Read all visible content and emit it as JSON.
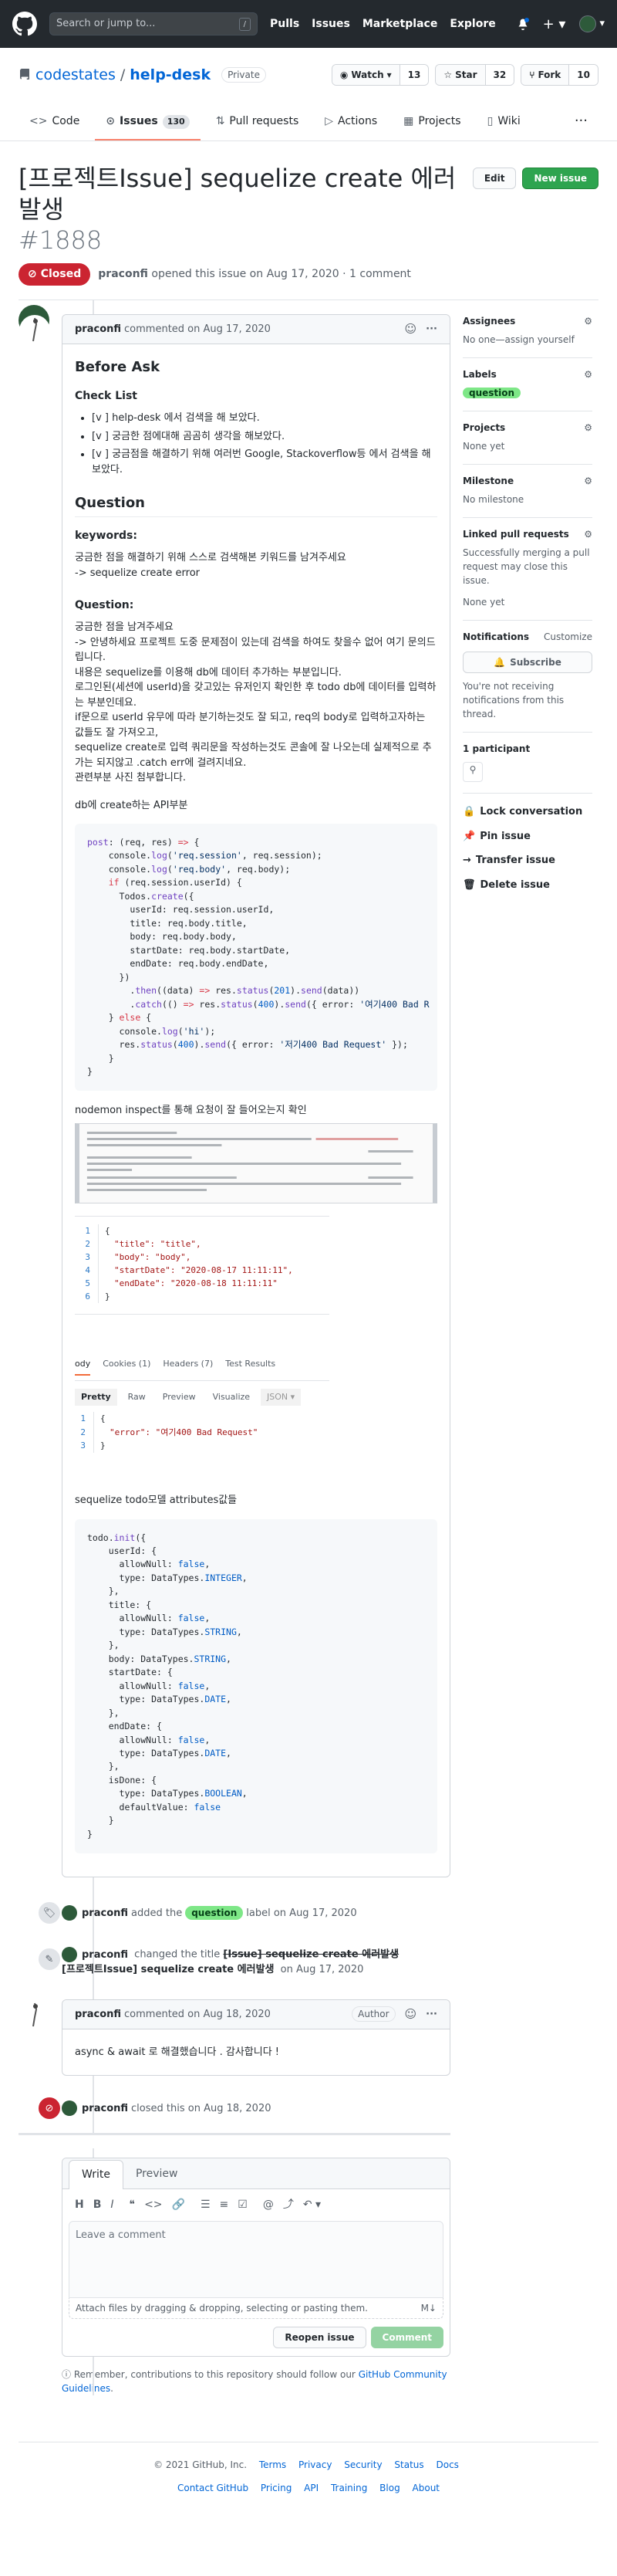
{
  "header": {
    "search_placeholder": "Search or jump to...",
    "search_key": "/",
    "nav": [
      "Pulls",
      "Issues",
      "Marketplace",
      "Explore"
    ]
  },
  "repo": {
    "owner": "codestates",
    "name": "help-desk",
    "visibility": "Private",
    "watch": {
      "label": "Watch",
      "count": "13"
    },
    "star": {
      "label": "Star",
      "count": "32"
    },
    "fork": {
      "label": "Fork",
      "count": "10"
    }
  },
  "tabs": [
    {
      "label": "Code"
    },
    {
      "label": "Issues",
      "count": "130"
    },
    {
      "label": "Pull requests"
    },
    {
      "label": "Actions"
    },
    {
      "label": "Projects"
    },
    {
      "label": "Wiki"
    }
  ],
  "issue": {
    "title": "[프로젝트Issue] sequelize create 에러발생",
    "number": "#1888",
    "edit_label": "Edit",
    "new_issue_label": "New issue",
    "state": "Closed",
    "meta_user": "praconfi",
    "meta_text": "opened this issue on Aug 17, 2020 · 1 comment"
  },
  "comment1": {
    "author": "praconfi",
    "date": "commented on Aug 17, 2020",
    "h_before": "Before Ask",
    "h_check": "Check List",
    "checks": [
      "[v ] help-desk 에서 검색을 해 보았다.",
      "[v ] 궁금한 점에대해 곰곰히 생각을 해보았다.",
      "[v ] 궁금점을 해결하기 위해 여러번 Google, Stackoverflow등 에서 검색을 해보았다."
    ],
    "h_question": "Question",
    "h_keywords": "keywords:",
    "keywords_1": "궁금한 점을 해결하기 위해 스스로 검색해본 키워드를 남겨주세요",
    "keywords_2": "-> sequelize create error",
    "h_q2": "Question:",
    "q_lines": [
      "궁금한 점을 남겨주세요",
      "-> 안녕하세요 프로젝트 도중 문제점이 있는데 검색을 하여도 찾을수 없어 여기 문의드립니다.",
      "내용은 sequelize를 이용해 db에 데이터 추가하는 부분입니다.",
      "로그인된(세션에 userId)을 갖고있는 유저인지 확인한 후 todo db에 데이터를 입력하는 부분인데요.",
      "if문으로 userId 유무에 따라 분기하는것도 잘 되고, req의 body로 입력하고자하는 값들도 잘 가져오고,",
      "sequelize create로 입력 쿼리문을 작성하는것도 콘솔에 잘 나오는데 실제적으로 추가는 되지않고 .catch err에 걸려지네요.",
      "관련부분 사진 첨부합니다."
    ],
    "db_create": "db에 create하는 API부분",
    "nodemon": "nodemon inspect를 통해 요청이 잘 들어오는지 확인",
    "postman_lines": [
      "{",
      "\"title\": \"title\",",
      "\"body\": \"body\",",
      "\"startDate\": \"2020-08-17 11:11:11\",",
      "\"endDate\": \"2020-08-18 11:11:11\"",
      "}"
    ],
    "resp_tabs": [
      "ody",
      "Cookies (1)",
      "Headers (7)",
      "Test Results"
    ],
    "resp_modes": [
      "Pretty",
      "Raw",
      "Preview",
      "Visualize",
      "JSON"
    ],
    "resp_lines": [
      "{",
      "\"error\": \"여기400 Bad Request\"",
      "}"
    ],
    "model_title": "sequelize todo모델 attributes값들"
  },
  "events": {
    "labeled": {
      "user": "praconfi",
      "pre": "added the",
      "label": "question",
      "post": "label on Aug 17, 2020"
    },
    "renamed": {
      "user": "praconfi",
      "pre": "changed the title",
      "old": "[Issue] sequelize create 에러발생",
      "new": "[프로젝트Issue] sequelize create 에러발생",
      "post": "on Aug 17, 2020"
    },
    "closed": {
      "user": "praconfi",
      "text": "closed this on Aug 18, 2020"
    }
  },
  "comment2": {
    "author": "praconfi",
    "date": "commented on Aug 18, 2020",
    "badge": "Author",
    "body": "async & await 로 해결했습니다 . 감사합니다 !"
  },
  "new_comment": {
    "tab_write": "Write",
    "tab_preview": "Preview",
    "placeholder": "Leave a comment",
    "attach": "Attach files by dragging & dropping, selecting or pasting them.",
    "reopen": "Reopen issue",
    "submit": "Comment",
    "remember_pre": "Remember, contributions to this repository should follow our",
    "remember_link": "GitHub Community Guidelines",
    "remember_post": "."
  },
  "sidebar": {
    "assignees": {
      "title": "Assignees",
      "value": "No one—assign yourself"
    },
    "labels": {
      "title": "Labels",
      "value": "question"
    },
    "projects": {
      "title": "Projects",
      "value": "None yet"
    },
    "milestone": {
      "title": "Milestone",
      "value": "No milestone"
    },
    "linked": {
      "title": "Linked pull requests",
      "desc": "Successfully merging a pull request may close this issue.",
      "value": "None yet"
    },
    "notifications": {
      "title": "Notifications",
      "customize": "Customize",
      "button": "Subscribe",
      "desc": "You're not receiving notifications from this thread."
    },
    "participants": "1 participant",
    "actions": [
      "Lock conversation",
      "Pin issue",
      "Transfer issue",
      "Delete issue"
    ]
  },
  "footer": {
    "copyright": "© 2021 GitHub, Inc.",
    "links1": [
      "Terms",
      "Privacy",
      "Security",
      "Status",
      "Docs"
    ],
    "links2": [
      "Contact GitHub",
      "Pricing",
      "API",
      "Training",
      "Blog",
      "About"
    ]
  },
  "colors": {
    "closed": "#cb2431",
    "green": "#2ea44f",
    "label_question": "#7ee787",
    "link": "#0366d6"
  }
}
